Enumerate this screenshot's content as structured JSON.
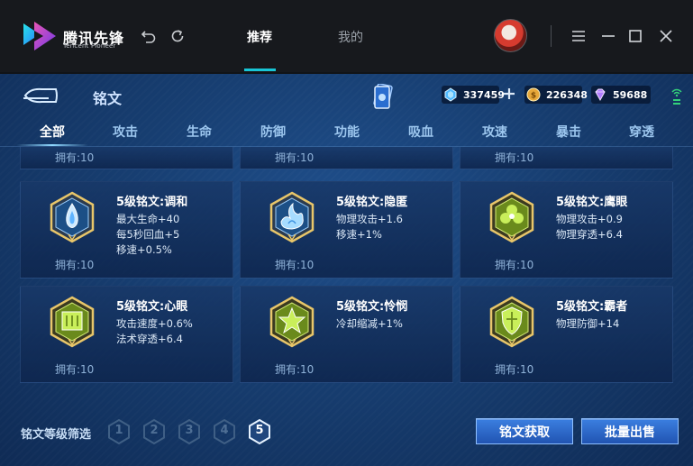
{
  "launcher": {
    "brand_name": "腾讯先锋",
    "brand_sub": "Tencent Pioneer",
    "tabs": [
      {
        "label": "推荐",
        "active": true
      },
      {
        "label": "我的",
        "active": false
      }
    ],
    "accent_color": "#18c6d6",
    "icons": [
      "undo-icon",
      "refresh-icon",
      "menu-icon",
      "minimize-icon",
      "maximize-icon",
      "close-icon"
    ]
  },
  "panel": {
    "title": "铭文",
    "currencies": [
      {
        "name": "diamond",
        "icon": "blue-crystal-icon",
        "amount": "337459"
      },
      {
        "name": "gold",
        "icon": "gold-coin-icon",
        "amount": "226348"
      },
      {
        "name": "gem",
        "icon": "purple-gem-icon",
        "amount": "59688"
      }
    ],
    "categories": [
      "全部",
      "攻击",
      "生命",
      "防御",
      "功能",
      "吸血",
      "攻速",
      "暴击",
      "穿透"
    ],
    "active_category": "全部"
  },
  "cards_partial": [
    {
      "own": "拥有:10"
    },
    {
      "own": "拥有:10"
    },
    {
      "own": "拥有:10"
    }
  ],
  "cards": [
    {
      "name": "5级铭文:调和",
      "stats": [
        "最大生命+40",
        "每5秒回血+5",
        "移速+0.5%"
      ],
      "own": "拥有:10",
      "color": "blue",
      "symbol": "drop"
    },
    {
      "name": "5级铭文:隐匿",
      "stats": [
        "物理攻击+1.6",
        "移速+1%"
      ],
      "own": "拥有:10",
      "color": "blue",
      "symbol": "flame"
    },
    {
      "name": "5级铭文:鹰眼",
      "stats": [
        "物理攻击+0.9",
        "物理穿透+6.4"
      ],
      "own": "拥有:10",
      "color": "green",
      "symbol": "flower"
    },
    {
      "name": "5级铭文:心眼",
      "stats": [
        "攻击速度+0.6%",
        "法术穿透+6.4"
      ],
      "own": "拥有:10",
      "color": "green",
      "symbol": "square"
    },
    {
      "name": "5级铭文:怜悯",
      "stats": [
        "冷却缩减+1%"
      ],
      "own": "拥有:10",
      "color": "green",
      "symbol": "star"
    },
    {
      "name": "5级铭文:霸者",
      "stats": [
        "物理防御+14"
      ],
      "own": "拥有:10",
      "color": "green",
      "symbol": "shield"
    }
  ],
  "footer": {
    "filter_label": "铭文等级筛选",
    "levels": [
      "1",
      "2",
      "3",
      "4",
      "5"
    ],
    "active_level": "5",
    "obtain_button": "铭文获取",
    "sell_button": "批量出售"
  }
}
